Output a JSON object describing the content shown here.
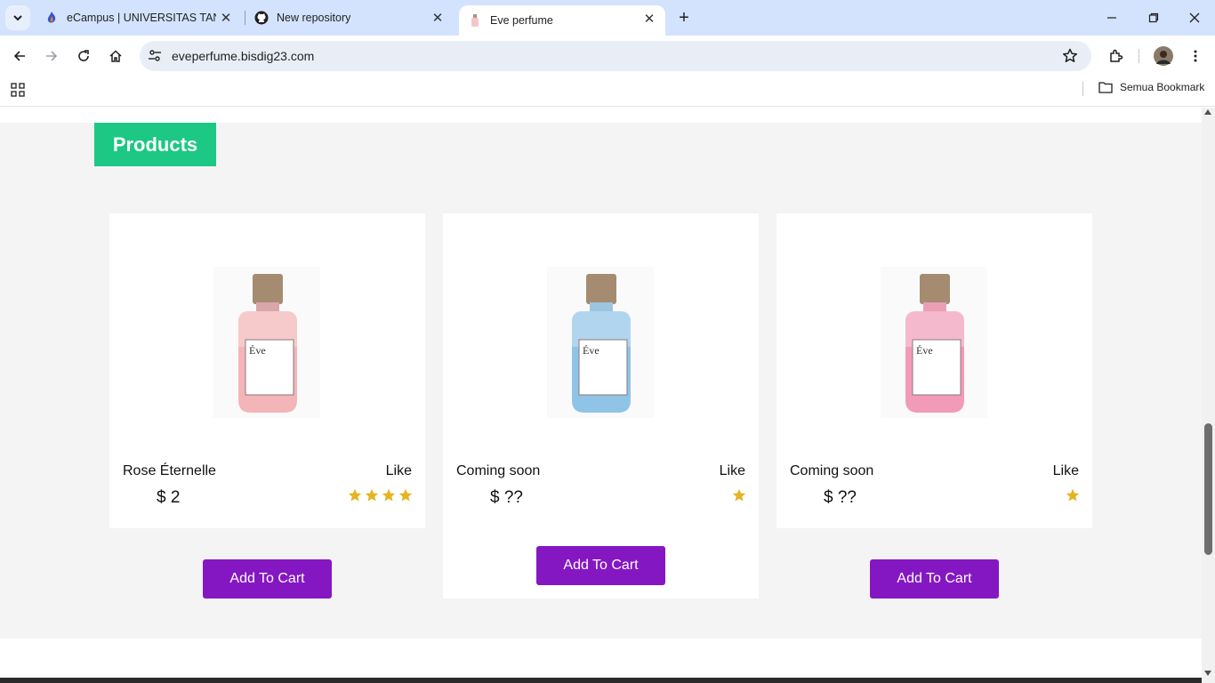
{
  "browser": {
    "tabs": [
      {
        "title": "eCampus | UNIVERSITAS TANGERANG",
        "icon": "flame-icon"
      },
      {
        "title": "New repository",
        "icon": "github-icon"
      },
      {
        "title": "Eve perfume",
        "icon": "perfume-icon",
        "active": true
      }
    ],
    "url": "eveperfume.bisdig23.com",
    "bookmarks_folder": "Semua Bookmark"
  },
  "page": {
    "section_title": "Products",
    "section_title_color": "#1cc883",
    "button_color": "#8517c3",
    "star_color": "#e6b422",
    "products": [
      {
        "name": "Rose Éternelle",
        "like_label": "Like",
        "price": "$ 2",
        "stars": 4,
        "bottle_color": "pink",
        "label_brand": "Éve",
        "button": "Add To Cart"
      },
      {
        "name": "Coming soon",
        "like_label": "Like",
        "price": "$ ??",
        "stars": 1,
        "bottle_color": "blue",
        "label_brand": "Éve",
        "button": "Add To Cart"
      },
      {
        "name": "Coming soon",
        "like_label": "Like",
        "price": "$ ??",
        "stars": 1,
        "bottle_color": "rose",
        "label_brand": "Éve",
        "button": "Add To Cart"
      }
    ]
  }
}
